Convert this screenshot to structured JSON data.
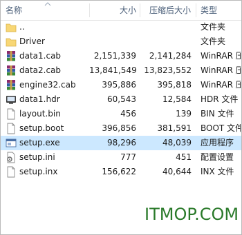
{
  "columns": {
    "name": "名称",
    "size": "大小",
    "packed": "压缩后大小",
    "type": "类型"
  },
  "rows": [
    {
      "name": "..",
      "size": "",
      "packed": "",
      "type": "文件夹",
      "icon": "folder-icon"
    },
    {
      "name": "Driver",
      "size": "",
      "packed": "",
      "type": "文件夹",
      "icon": "folder-icon"
    },
    {
      "name": "data1.cab",
      "size": "2,151,339",
      "packed": "2,141,284",
      "type": "WinRAR 压",
      "icon": "winrar-archive-icon"
    },
    {
      "name": "data2.cab",
      "size": "13,841,549",
      "packed": "13,823,552",
      "type": "WinRAR 压",
      "icon": "winrar-archive-icon"
    },
    {
      "name": "engine32.cab",
      "size": "395,886",
      "packed": "395,818",
      "type": "WinRAR 压",
      "icon": "winrar-archive-icon"
    },
    {
      "name": "data1.hdr",
      "size": "60,543",
      "packed": "12,584",
      "type": "HDR 文件",
      "icon": "hdr-file-icon"
    },
    {
      "name": "layout.bin",
      "size": "456",
      "packed": "139",
      "type": "BIN 文件",
      "icon": "file-icon"
    },
    {
      "name": "setup.boot",
      "size": "396,856",
      "packed": "381,591",
      "type": "BOOT 文件",
      "icon": "file-icon"
    },
    {
      "name": "setup.exe",
      "size": "98,296",
      "packed": "48,039",
      "type": "应用程序",
      "icon": "exe-icon",
      "selected": true
    },
    {
      "name": "setup.ini",
      "size": "777",
      "packed": "451",
      "type": "配置设置",
      "icon": "ini-file-icon"
    },
    {
      "name": "setup.inx",
      "size": "156,622",
      "packed": "40,644",
      "type": "INX 文件",
      "icon": "file-icon"
    }
  ],
  "watermark": "ITMOP.COM",
  "colors": {
    "selection": "#cce8ff",
    "folder": "#f8d775",
    "watermark": "#2a7a2a"
  }
}
